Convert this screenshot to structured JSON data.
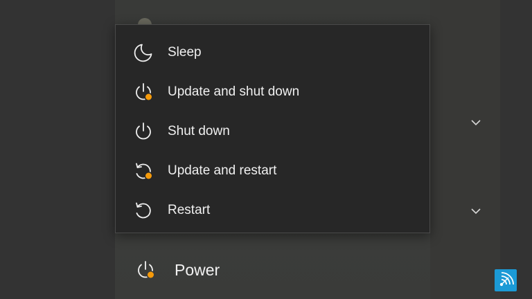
{
  "colors": {
    "background": "#333333",
    "menu_background": "#272727",
    "text": "#f0f0f0",
    "update_badge": "#f59a0a",
    "logo_background": "#1b9ad6"
  },
  "power_menu": {
    "items": [
      {
        "label": "Sleep",
        "icon": "moon-icon",
        "has_update_badge": false
      },
      {
        "label": "Update and shut down",
        "icon": "power-icon",
        "has_update_badge": true
      },
      {
        "label": "Shut down",
        "icon": "power-icon",
        "has_update_badge": false
      },
      {
        "label": "Update and restart",
        "icon": "restart-icon",
        "has_update_badge": true
      },
      {
        "label": "Restart",
        "icon": "restart-icon",
        "has_update_badge": false
      }
    ]
  },
  "start_menu": {
    "power_label": "Power",
    "power_icon": "power-icon",
    "power_has_update_badge": true
  },
  "watermark": {
    "icon": "wireless-signal-logo"
  }
}
